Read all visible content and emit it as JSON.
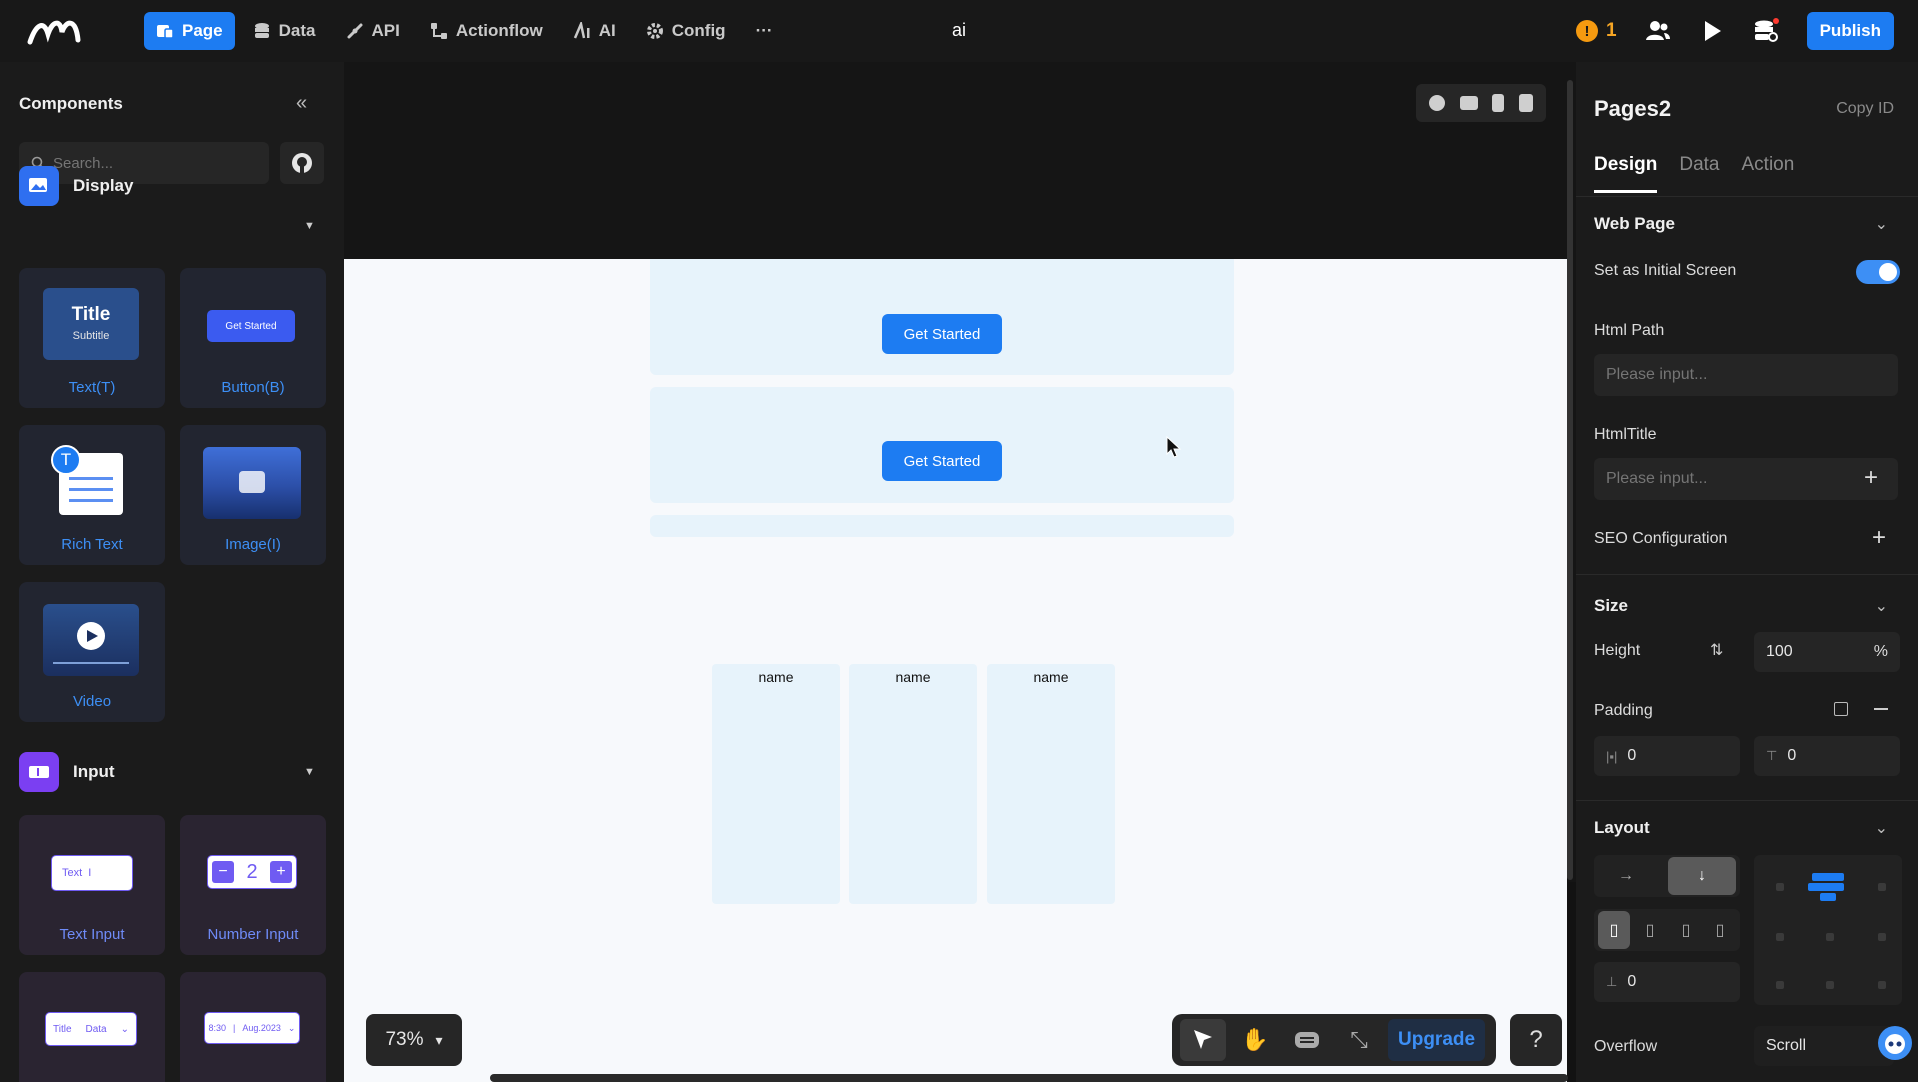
{
  "topbar": {
    "nav": [
      {
        "label": "Page",
        "icon": "page-icon",
        "active": true
      },
      {
        "label": "Data",
        "icon": "database-icon"
      },
      {
        "label": "API",
        "icon": "api-icon"
      },
      {
        "label": "Actionflow",
        "icon": "flow-icon"
      },
      {
        "label": "AI",
        "icon": "ai-icon"
      },
      {
        "label": "Config",
        "icon": "gear-icon"
      }
    ],
    "more": "···",
    "project_name": "ai",
    "warning_count": "1",
    "warning_glyph": "!",
    "publish": "Publish"
  },
  "left": {
    "title": "Components",
    "search_placeholder": "Search...",
    "display_section": "Display",
    "display_items": [
      {
        "label": "Text(T)",
        "preview_title": "Title",
        "preview_sub": "Subtitle"
      },
      {
        "label": "Button(B)",
        "preview": "Get Started"
      },
      {
        "label": "Rich Text",
        "badge": "T"
      },
      {
        "label": "Image(I)"
      },
      {
        "label": "Video"
      }
    ],
    "input_section": "Input",
    "input_items": [
      {
        "label": "Text Input",
        "preview": "Text"
      },
      {
        "label": "Number Input",
        "preview": "2"
      }
    ],
    "select_preview": {
      "title": "Title",
      "value": "Data"
    },
    "date_preview": {
      "time": "8:30",
      "date": "Aug.2023"
    }
  },
  "canvas": {
    "buttons": [
      "Get Started",
      "Get Started"
    ],
    "columns": [
      "name",
      "name",
      "name"
    ],
    "zoom": "73%",
    "upgrade": "Upgrade",
    "help": "?"
  },
  "right": {
    "title": "Pages2",
    "copy_id": "Copy ID",
    "tabs": [
      "Design",
      "Data",
      "Action"
    ],
    "web_page": "Web Page",
    "initial_screen": "Set as Initial Screen",
    "initial_screen_on": true,
    "html_path": "Html Path",
    "html_path_placeholder": "Please input...",
    "html_title": "HtmlTitle",
    "html_title_placeholder": "Please input...",
    "seo": "SEO Configuration",
    "size": "Size",
    "height_label": "Height",
    "height_value": "100",
    "height_unit": "%",
    "padding_label": "Padding",
    "padding_h": "0",
    "padding_v": "0",
    "layout": "Layout",
    "gap_value": "0",
    "overflow_label": "Overflow",
    "overflow_value": "Scroll"
  },
  "colors": {
    "accent": "#1d7cf2",
    "warning": "#f59a10",
    "block": "#e7f3fb"
  }
}
